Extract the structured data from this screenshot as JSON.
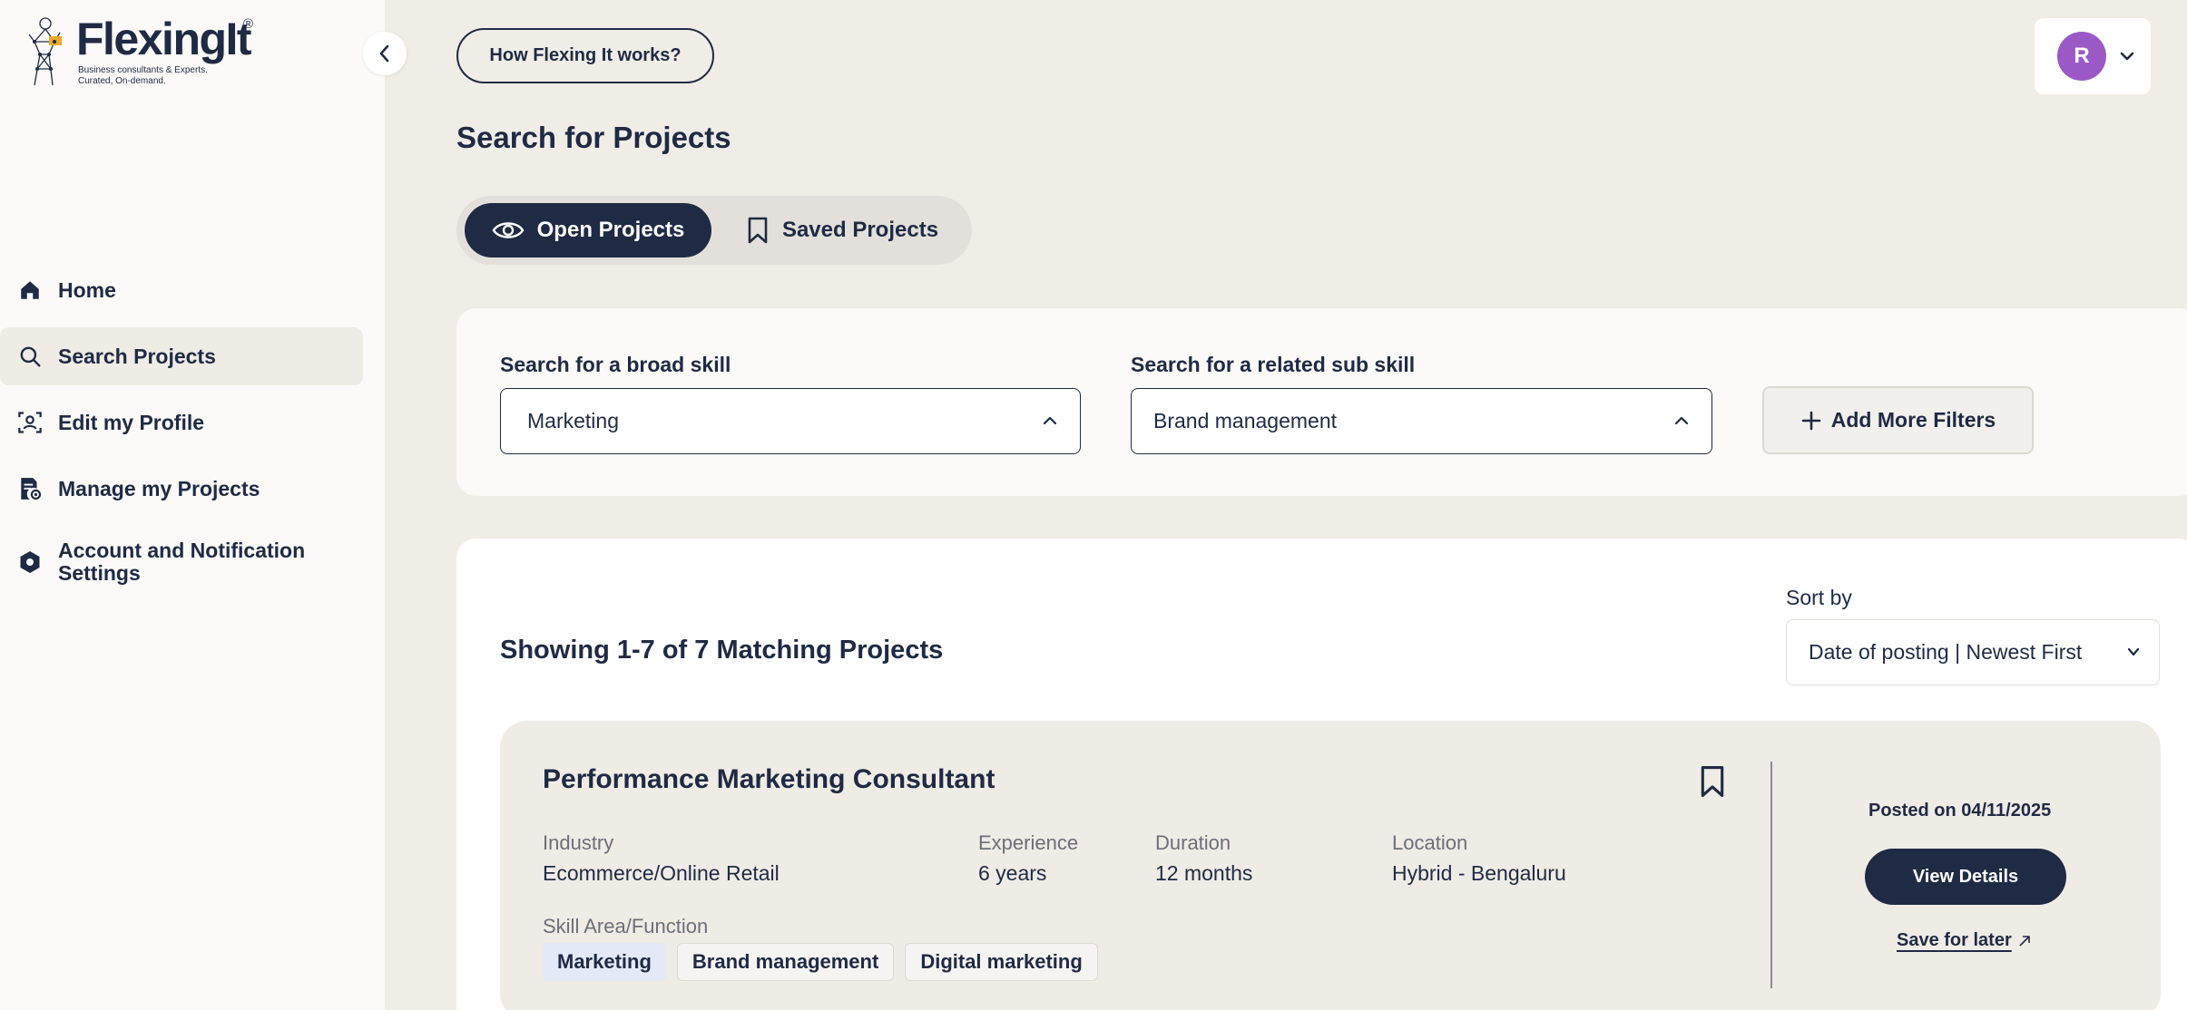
{
  "brand": {
    "name": "FlexingIt",
    "registered": "®",
    "tagline_1": "Business consultants & Experts.",
    "tagline_2": "Curated, On-demand."
  },
  "sidebar": {
    "items": [
      {
        "label": "Home",
        "icon": "home-icon",
        "active": false
      },
      {
        "label": "Search Projects",
        "icon": "search-icon",
        "active": true
      },
      {
        "label": "Edit my Profile",
        "icon": "profile-icon",
        "active": false
      },
      {
        "label": "Manage my Projects",
        "icon": "projects-icon",
        "active": false
      },
      {
        "label": "Account and Notification Settings",
        "icon": "settings-icon",
        "active": false
      }
    ]
  },
  "header": {
    "how_it_works": "How Flexing It works?",
    "avatar_initial": "R",
    "avatar_color": "#9b59c6"
  },
  "page": {
    "title": "Search for Projects",
    "tabs": [
      {
        "label": "Open Projects",
        "active": true
      },
      {
        "label": "Saved Projects",
        "active": false
      }
    ]
  },
  "filters": {
    "broad_skill_label": "Search for a broad skill",
    "broad_skill_value": "Marketing",
    "sub_skill_label": "Search for a related sub skill",
    "sub_skill_value": "Brand management",
    "add_filters_label": "Add More Filters"
  },
  "results": {
    "summary": "Showing 1-7 of 7 Matching Projects",
    "sort_label": "Sort by",
    "sort_value": "Date of posting | Newest First",
    "projects": [
      {
        "title": "Performance Marketing Consultant",
        "industry_label": "Industry",
        "industry": "Ecommerce/Online Retail",
        "experience_label": "Experience",
        "experience": "6 years",
        "duration_label": "Duration",
        "duration": "12 months",
        "location_label": "Location",
        "location": "Hybrid - Bengaluru",
        "skills_label": "Skill Area/Function",
        "skills": [
          "Marketing",
          "Brand management",
          "Digital marketing"
        ],
        "posted": "Posted on 04/11/2025",
        "view_details": "View Details",
        "save_later": "Save for later"
      }
    ]
  },
  "colors": {
    "navy": "#1f2a44",
    "page_bg": "#f0ede7",
    "sidebar_bg": "#fbfaf8",
    "card_bg": "#efebe5",
    "chip_primary": "#e3e9f6"
  }
}
